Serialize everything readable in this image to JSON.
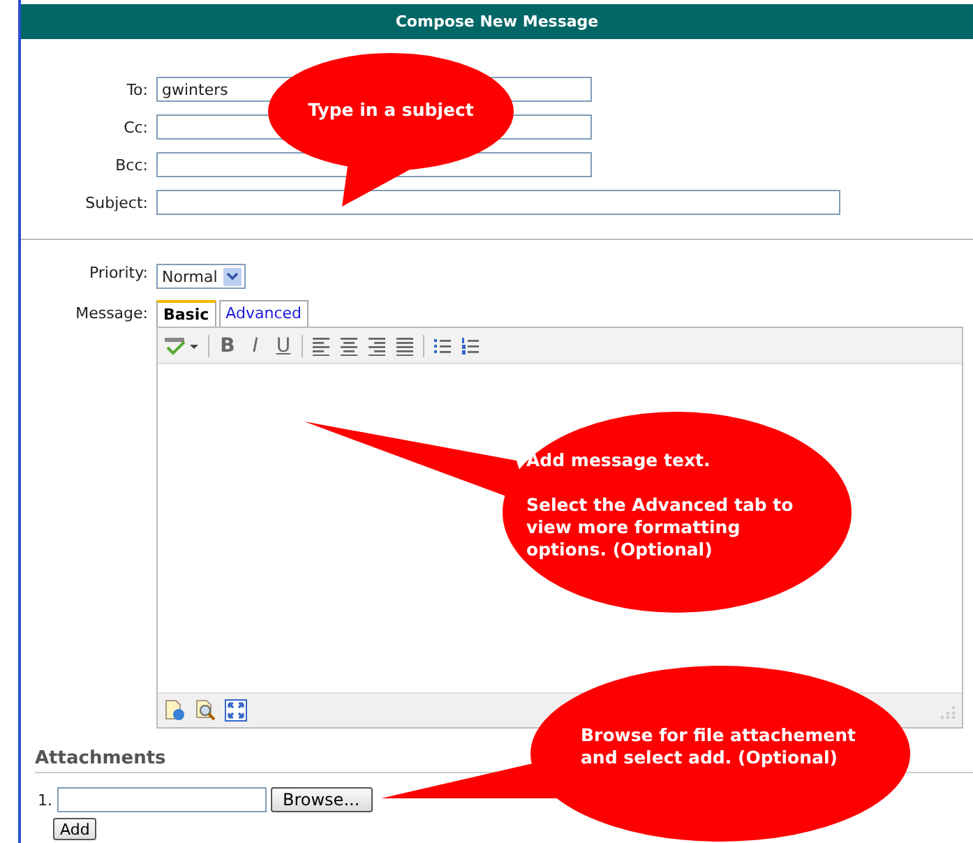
{
  "header": {
    "title": "Compose New Message"
  },
  "recipients": [
    {
      "label": "To:",
      "value": "gwinters"
    },
    {
      "label": "Cc:"
    },
    {
      "label": "Bcc:"
    },
    {
      "label": "Subject:"
    }
  ],
  "priority": {
    "label": "Priority:",
    "value": "Normal"
  },
  "message": {
    "label": "Message:",
    "tabs": [
      {
        "label": "Basic",
        "selected": true
      },
      {
        "label": "Advanced",
        "selected": false
      }
    ],
    "format_buttons": [
      "B",
      "I",
      "U"
    ]
  },
  "attachments": {
    "title": "Attachments",
    "rows": [
      {
        "number": "1.",
        "button": "Browse..."
      }
    ],
    "add_button": "Add"
  },
  "callouts": [
    {
      "paragraphs": [
        "Type in a subject"
      ]
    },
    {
      "paragraphs": [
        "Add message text.",
        "Select the Advanced tab to view more formatting options. (Optional)"
      ]
    },
    {
      "paragraphs": [
        "Browse for file attachement and select add. (Optional)"
      ]
    }
  ]
}
